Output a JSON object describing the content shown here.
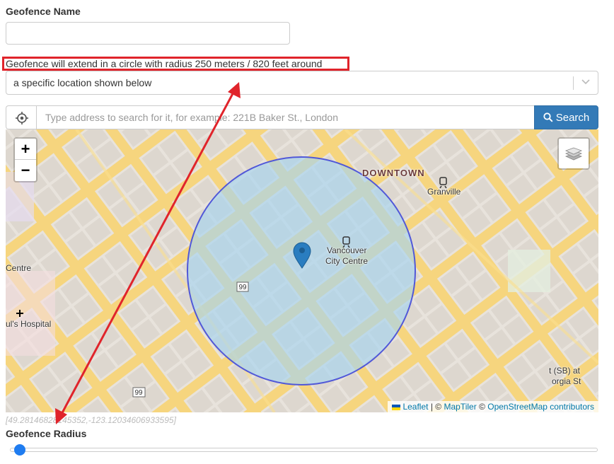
{
  "form": {
    "name_label": "Geofence Name",
    "name_value": "",
    "description": "Geofence will extend in a circle with radius 250 meters / 820 feet around",
    "select_value": "a specific location shown below",
    "search_placeholder": "Type address to search for it, for example: 221B Baker St., London",
    "search_button": "Search",
    "coords": "[49.28146828145352,-123.12034606933595]",
    "radius_label": "Geofence Radius",
    "radius_slider_fraction": 0.01
  },
  "map": {
    "labels": {
      "downtown": "DOWNTOWN",
      "granville": "Granville",
      "vancouver": "Vancouver",
      "city_centre": "City Centre",
      "centre": "Centre",
      "hospital": "ul's Hospital",
      "sb_at": "t (SB) at",
      "orgia": "orgia St",
      "hwy1": "99",
      "hwy2": "99"
    },
    "zoom_in": "+",
    "zoom_out": "−",
    "attribution": {
      "leaflet": "Leaflet",
      "sep": "|",
      "copy1": "©",
      "maptiler": "MapTiler",
      "copy2": "©",
      "osm": "OpenStreetMap contributors"
    }
  },
  "colors": {
    "circle_fill": "#a6d4ef",
    "circle_stroke": "#5158d8",
    "marker": "#2a7dc0",
    "annotation": "#e0242b",
    "search_button": "#337ab7"
  }
}
